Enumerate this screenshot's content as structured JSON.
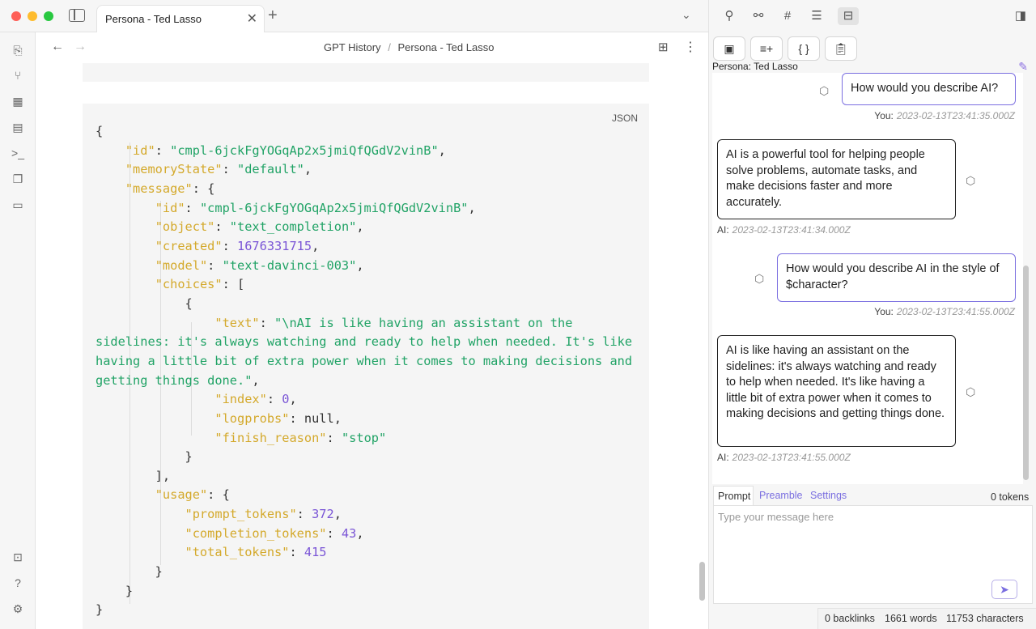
{
  "window": {
    "tab_title": "Persona - Ted Lasso"
  },
  "nav": {
    "breadcrumb_parent": "GPT History",
    "breadcrumb_sep": "/",
    "breadcrumb_current": "Persona - Ted Lasso"
  },
  "code": {
    "lang": "JSON",
    "lines": [
      "{",
      "    \"id\": \"cmpl-6jckFgYOGqAp2x5jmiQfQGdV2vinB\",",
      "    \"memoryState\": \"default\",",
      "    \"message\": {",
      "        \"id\": \"cmpl-6jckFgYOGqAp2x5jmiQfQGdV2vinB\",",
      "        \"object\": \"text_completion\",",
      "        \"created\": 1676331715,",
      "        \"model\": \"text-davinci-003\",",
      "        \"choices\": [",
      "            {",
      "                \"text\": \"\\nAI is like having an assistant on the",
      "sidelines: it's always watching and ready to help when needed. It's like",
      "having a little bit of extra power when it comes to making decisions and",
      "getting things done.\",",
      "                \"index\": 0,",
      "                \"logprobs\": null,",
      "                \"finish_reason\": \"stop\"",
      "            }",
      "        ],",
      "        \"usage\": {",
      "            \"prompt_tokens\": 372,",
      "            \"completion_tokens\": 43,",
      "            \"total_tokens\": 415",
      "        }",
      "    }",
      "}"
    ]
  },
  "sidebar": {
    "persona_label": "Persona: Ted Lasso",
    "messages": [
      {
        "role": "user",
        "text": "How would you describe AI?",
        "sender": "You:",
        "time": "2023-02-13T23:41:35.000Z"
      },
      {
        "role": "ai",
        "text": "AI is a powerful tool for helping people solve problems, automate tasks, and make decisions faster and more accurately.",
        "sender": "AI:",
        "time": "2023-02-13T23:41:34.000Z"
      },
      {
        "role": "user",
        "text": "How would you describe AI in the style of $character?",
        "sender": "You:",
        "time": "2023-02-13T23:41:55.000Z"
      },
      {
        "role": "ai",
        "text": "AI is like having an assistant on the sidelines: it's always watching and ready to help when needed. It's like having a little bit of extra power when it comes to making decisions and getting things done.",
        "sender": "AI:",
        "time": "2023-02-13T23:41:55.000Z"
      }
    ],
    "tabs": {
      "prompt": "Prompt",
      "preamble": "Preamble",
      "settings": "Settings"
    },
    "token_count": "0 tokens",
    "input_placeholder": "Type your message here"
  },
  "status": {
    "backlinks": "0 backlinks",
    "words": "1661 words",
    "characters": "11753 characters"
  },
  "colors": {
    "accent": "#7a6ee0",
    "key": "#d4a92b",
    "string": "#21a366",
    "number": "#7a55d6"
  }
}
